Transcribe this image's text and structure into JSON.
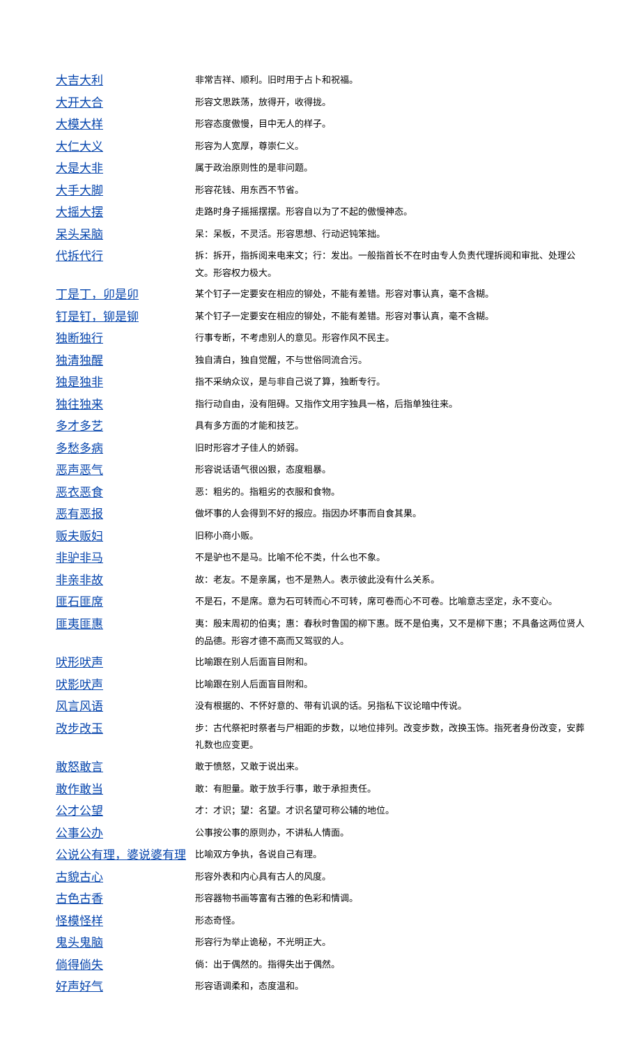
{
  "entries": [
    {
      "term": "大吉大利",
      "def": "非常吉祥、顺利。旧时用于占卜和祝福。"
    },
    {
      "term": "大开大合",
      "def": "形容文思跌荡，放得开，收得拢。"
    },
    {
      "term": "大模大样",
      "def": "形容态度傲慢，目中无人的样子。"
    },
    {
      "term": "大仁大义",
      "def": "形容为人宽厚，尊崇仁义。"
    },
    {
      "term": "大是大非",
      "def": "属于政治原则性的是非问题。"
    },
    {
      "term": "大手大脚",
      "def": "形容花钱、用东西不节省。"
    },
    {
      "term": "大摇大摆",
      "def": "走路时身子摇摇摆摆。形容自以为了不起的傲慢神态。"
    },
    {
      "term": "呆头呆脑",
      "def": "呆：呆板，不灵活。形容思想、行动迟钝笨拙。"
    },
    {
      "term": "代拆代行",
      "def": "拆：拆开，指拆阅来电来文；行：发出。一般指首长不在时由专人负责代理拆阅和审批、处理公文。形容权力极大。"
    },
    {
      "term": "丁是丁，卯是卯",
      "def": "某个钉子一定要安在相应的铆处，不能有差错。形容对事认真，毫不含糊。"
    },
    {
      "term": "钉是钉，铆是铆",
      "def": "某个钉子一定要安在相应的铆处，不能有差错。形容对事认真，毫不含糊。"
    },
    {
      "term": "独断独行",
      "def": "行事专断，不考虑别人的意见。形容作风不民主。"
    },
    {
      "term": "独清独醒",
      "def": "独自清白，独自觉醒，不与世俗同流合污。"
    },
    {
      "term": "独是独非",
      "def": "指不采纳众议，是与非自己说了算，独断专行。"
    },
    {
      "term": "独往独来",
      "def": "指行动自由，没有阻碍。又指作文用字独具一格，后指单独往来。"
    },
    {
      "term": "多才多艺",
      "def": "具有多方面的才能和技艺。"
    },
    {
      "term": "多愁多病",
      "def": "旧时形容才子佳人的娇弱。"
    },
    {
      "term": "恶声恶气",
      "def": "形容说话语气很凶狠，态度粗暴。"
    },
    {
      "term": "恶衣恶食",
      "def": "恶：粗劣的。指粗劣的衣服和食物。"
    },
    {
      "term": "恶有恶报",
      "def": "做坏事的人会得到不好的报应。指因办坏事而自食其果。"
    },
    {
      "term": "贩夫贩妇",
      "def": "旧称小商小贩。"
    },
    {
      "term": "非驴非马",
      "def": "不是驴也不是马。比喻不伦不类，什么也不象。"
    },
    {
      "term": "非亲非故",
      "def": "故：老友。不是亲属，也不是熟人。表示彼此没有什么关系。"
    },
    {
      "term": "匪石匪席",
      "def": "不是石，不是席。意为石可转而心不可转，席可卷而心不可卷。比喻意志坚定，永不变心。"
    },
    {
      "term": "匪夷匪惠",
      "def": "夷：殷末周初的伯夷；惠：春秋时鲁国的柳下惠。既不是伯夷，又不是柳下惠；不具备这两位贤人的品德。形容才德不高而又驾驭的人。"
    },
    {
      "term": "吠形吠声",
      "def": "比喻跟在别人后面盲目附和。"
    },
    {
      "term": "吠影吠声",
      "def": "比喻跟在别人后面盲目附和。"
    },
    {
      "term": "风言风语",
      "def": "没有根据的、不怀好意的、带有讥讽的话。另指私下议论暗中传说。"
    },
    {
      "term": "改步改玉",
      "def": "步：古代祭祀时祭者与尸相距的步数，以地位排列。改变步数，改换玉饰。指死者身份改变，安葬礼数也应变更。"
    },
    {
      "term": "敢怒敢言",
      "def": "敢于愤怒，又敢于说出来。"
    },
    {
      "term": "敢作敢当",
      "def": "敢：有胆量。敢于放手行事，敢于承担责任。"
    },
    {
      "term": "公才公望",
      "def": "才：才识；望：名望。才识名望可称公辅的地位。"
    },
    {
      "term": "公事公办",
      "def": "公事按公事的原则办，不讲私人情面。"
    },
    {
      "term": "公说公有理，婆说婆有理",
      "def": "比喻双方争执，各说自己有理。"
    },
    {
      "term": "古貌古心",
      "def": "形容外表和内心具有古人的风度。"
    },
    {
      "term": "古色古香",
      "def": "形容器物书画等富有古雅的色彩和情调。"
    },
    {
      "term": "怪模怪样",
      "def": "形态奇怪。"
    },
    {
      "term": "鬼头鬼脑",
      "def": "形容行为举止诡秘，不光明正大。"
    },
    {
      "term": "倘得倘失",
      "def": "倘：出于偶然的。指得失出于偶然。"
    },
    {
      "term": "好声好气",
      "def": "形容语调柔和，态度温和。"
    }
  ]
}
